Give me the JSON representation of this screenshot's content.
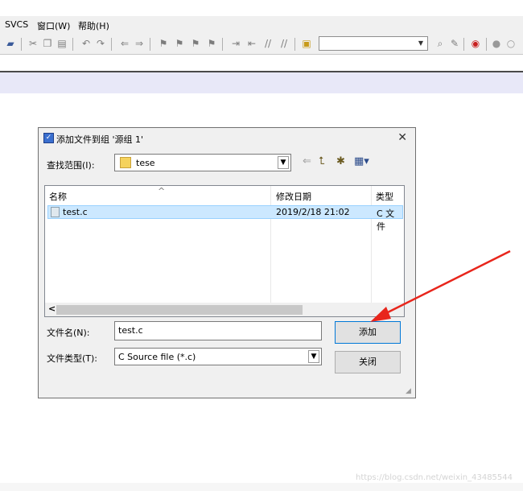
{
  "menubar": {
    "items": [
      "SVCS",
      "窗口(W)",
      "帮助(H)"
    ]
  },
  "toolbar": {
    "icons": [
      "save-all-icon",
      "cut-icon",
      "copy-icon",
      "paste-icon",
      "undo-icon",
      "redo-icon",
      "back-icon",
      "forward-icon",
      "bookmark-icon",
      "prev-bookmark-icon",
      "next-bookmark-icon",
      "clear-bookmark-icon",
      "indent-icon",
      "unindent-icon",
      "comment-icon",
      "uncomment-icon",
      "find-in-files-icon",
      "config-icon",
      "debug-icon",
      "circle-icon",
      "circle-outline-icon"
    ],
    "find_combo_value": ""
  },
  "dialog": {
    "title": "添加文件到组 '源组 1'",
    "close_glyph": "✕",
    "lookin_label": "查找范围(I):",
    "lookin_value": "tese",
    "columns": {
      "name": "名称",
      "date": "修改日期",
      "type": "类型"
    },
    "files": [
      {
        "name": "test.c",
        "date": "2019/2/18 21:02",
        "type": "C 文件"
      }
    ],
    "scroll_left_glyph": "<",
    "filename_label": "文件名(N):",
    "filename_value": "test.c",
    "filetype_label": "文件类型(T):",
    "filetype_value": "C Source file (*.c)",
    "add_button": "添加",
    "close_button": "关闭"
  },
  "colors": {
    "annotation_arrow": "#e8261c",
    "selection": "#cce8ff"
  },
  "watermark": "https://blog.csdn.net/weixin_43485544"
}
